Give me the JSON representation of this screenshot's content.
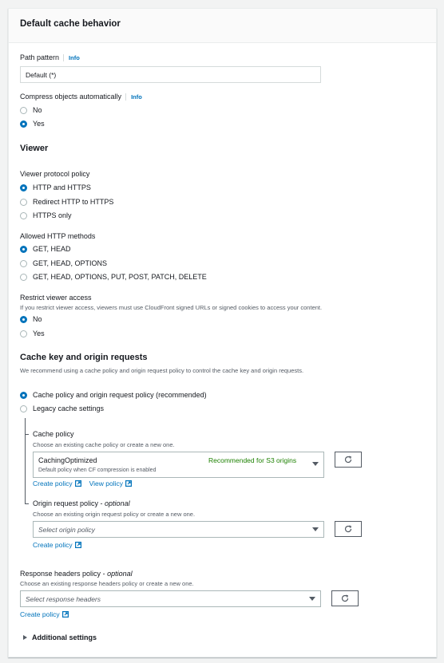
{
  "panel": {
    "title": "Default cache behavior"
  },
  "path_pattern": {
    "label": "Path pattern",
    "info": "Info",
    "value": "Default (*)"
  },
  "compress": {
    "label": "Compress objects automatically",
    "info": "Info",
    "options": [
      {
        "label": "No",
        "selected": false
      },
      {
        "label": "Yes",
        "selected": true
      }
    ]
  },
  "viewer": {
    "heading": "Viewer",
    "protocol": {
      "label": "Viewer protocol policy",
      "options": [
        {
          "label": "HTTP and HTTPS",
          "selected": true
        },
        {
          "label": "Redirect HTTP to HTTPS",
          "selected": false
        },
        {
          "label": "HTTPS only",
          "selected": false
        }
      ]
    },
    "methods": {
      "label": "Allowed HTTP methods",
      "options": [
        {
          "label": "GET, HEAD",
          "selected": true
        },
        {
          "label": "GET, HEAD, OPTIONS",
          "selected": false
        },
        {
          "label": "GET, HEAD, OPTIONS, PUT, POST, PATCH, DELETE",
          "selected": false
        }
      ]
    },
    "restrict": {
      "label": "Restrict viewer access",
      "description": "If you restrict viewer access, viewers must use CloudFront signed URLs or signed cookies to access your content.",
      "options": [
        {
          "label": "No",
          "selected": true
        },
        {
          "label": "Yes",
          "selected": false
        }
      ]
    }
  },
  "cache_key": {
    "heading": "Cache key and origin requests",
    "description": "We recommend using a cache policy and origin request policy to control the cache key and origin requests.",
    "options": [
      {
        "label": "Cache policy and origin request policy (recommended)",
        "selected": true
      },
      {
        "label": "Legacy cache settings",
        "selected": false
      }
    ],
    "cache_policy": {
      "label": "Cache policy",
      "description": "Choose an existing cache policy or create a new one.",
      "selected_value": "CachingOptimized",
      "selected_description": "Default policy when CF compression is enabled",
      "selected_tag": "Recommended for S3 origins",
      "create_link": "Create policy",
      "view_link": "View policy"
    },
    "origin_request_policy": {
      "label": "Origin request policy",
      "optional": "optional",
      "description": "Choose an existing origin request policy or create a new one.",
      "placeholder": "Select origin policy",
      "create_link": "Create policy"
    }
  },
  "response_headers": {
    "label": "Response headers policy",
    "optional": "optional",
    "description": "Choose an existing response headers policy or create a new one.",
    "placeholder": "Select response headers",
    "create_link": "Create policy"
  },
  "additional_settings": {
    "label": "Additional settings",
    "expanded": false
  },
  "colors": {
    "accent": "#0073bb",
    "recommended": "#1d8102",
    "text": "#16191f",
    "muted": "#545b64"
  }
}
